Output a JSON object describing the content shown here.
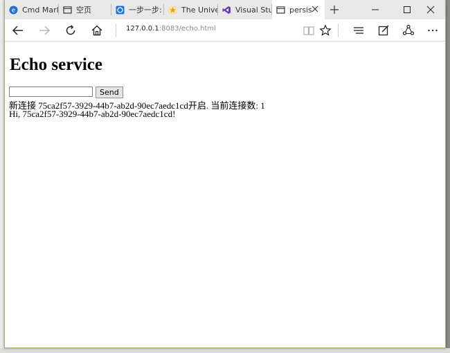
{
  "browser": {
    "tabs": [
      {
        "label": "Cmd Marl",
        "icon": "edge-e-icon",
        "color": "#1e6fd1",
        "active": false
      },
      {
        "label": "空页",
        "icon": "blank-page-icon",
        "active": false
      },
      {
        "label": "一步一步:",
        "icon": "circle-site-icon",
        "color": "#1a73e8",
        "active": false
      },
      {
        "label": "The Unive",
        "icon": "star-site-icon",
        "color": "#e0a500",
        "active": false
      },
      {
        "label": "Visual Stu",
        "icon": "visual-studio-icon",
        "color": "#6a3bb5",
        "active": false
      },
      {
        "label": "persis",
        "icon": "blank-page-icon",
        "active": true
      }
    ],
    "url": {
      "host": "127.0.0.1",
      "port_path": ":8083/echo.html"
    }
  },
  "page": {
    "title": "Echo service",
    "input": {
      "value": "",
      "placeholder": ""
    },
    "send_label": "Send",
    "log": [
      "新连接 75ca2f57-3929-44b7-ab2d-90ec7aedc1cd开启. 当前连接数: 1",
      "Hi, 75ca2f57-3929-44b7-ab2d-90ec7aedc1cd!"
    ]
  }
}
